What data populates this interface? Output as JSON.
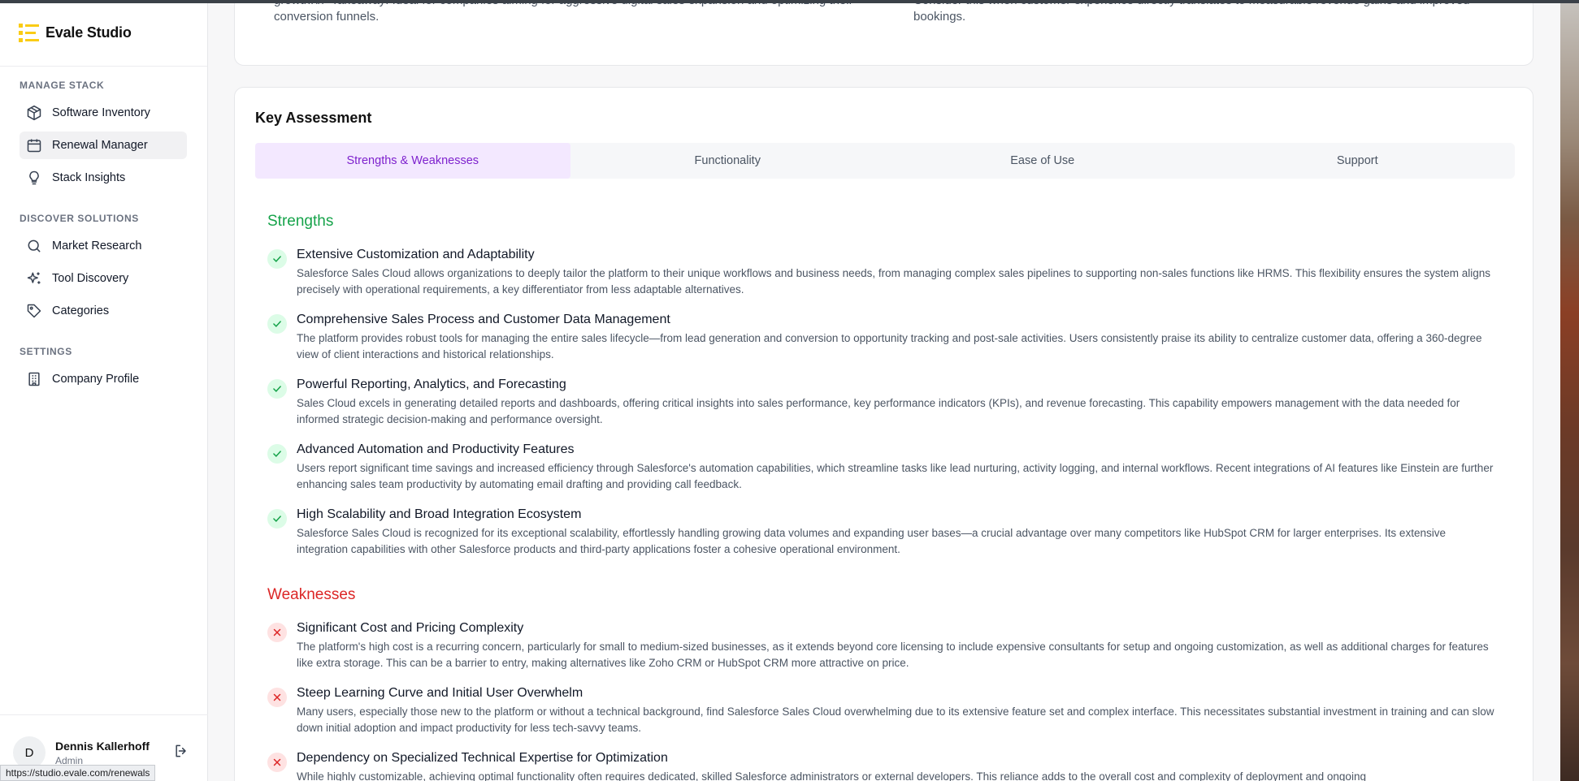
{
  "brand": {
    "name": "Evale Studio"
  },
  "sidebar": {
    "sections": [
      {
        "label": "MANAGE STACK",
        "items": [
          {
            "label": "Software Inventory",
            "icon": "box-icon"
          },
          {
            "label": "Renewal Manager",
            "icon": "calendar-icon",
            "active": true
          },
          {
            "label": "Stack Insights",
            "icon": "lightbulb-icon"
          }
        ]
      },
      {
        "label": "DISCOVER SOLUTIONS",
        "items": [
          {
            "label": "Market Research",
            "icon": "search-icon"
          },
          {
            "label": "Tool Discovery",
            "icon": "sparkles-icon"
          },
          {
            "label": "Categories",
            "icon": "tag-icon"
          }
        ]
      },
      {
        "label": "SETTINGS",
        "items": [
          {
            "label": "Company Profile",
            "icon": "building-icon"
          }
        ]
      }
    ]
  },
  "user": {
    "initial": "D",
    "name": "Dennis Kallerhoff",
    "role": "Admin"
  },
  "status_url": "https://studio.evale.com/renewals",
  "top_card": {
    "left_text": "growth.\\n- Takeaway: Ideal for companies aiming for aggressive digital sales expansion and optimizing their conversion funnels.",
    "right_text": "Consider this when customer experience directly translates to measurable revenue gains and improved bookings."
  },
  "assessment": {
    "title": "Key Assessment",
    "tabs": [
      "Strengths & Weaknesses",
      "Functionality",
      "Ease of Use",
      "Support"
    ],
    "active_tab": 0,
    "strengths_heading": "Strengths",
    "weaknesses_heading": "Weaknesses",
    "strengths": [
      {
        "title": "Extensive Customization and Adaptability",
        "desc": "Salesforce Sales Cloud allows organizations to deeply tailor the platform to their unique workflows and business needs, from managing complex sales pipelines to supporting non-sales functions like HRMS. This flexibility ensures the system aligns precisely with operational requirements, a key differentiator from less adaptable alternatives."
      },
      {
        "title": "Comprehensive Sales Process and Customer Data Management",
        "desc": "The platform provides robust tools for managing the entire sales lifecycle—from lead generation and conversion to opportunity tracking and post-sale activities. Users consistently praise its ability to centralize customer data, offering a 360-degree view of client interactions and historical relationships."
      },
      {
        "title": "Powerful Reporting, Analytics, and Forecasting",
        "desc": "Sales Cloud excels in generating detailed reports and dashboards, offering critical insights into sales performance, key performance indicators (KPIs), and revenue forecasting. This capability empowers management with the data needed for informed strategic decision-making and performance oversight."
      },
      {
        "title": "Advanced Automation and Productivity Features",
        "desc": "Users report significant time savings and increased efficiency through Salesforce's automation capabilities, which streamline tasks like lead nurturing, activity logging, and internal workflows. Recent integrations of AI features like Einstein are further enhancing sales team productivity by automating email drafting and providing call feedback."
      },
      {
        "title": "High Scalability and Broad Integration Ecosystem",
        "desc": "Salesforce Sales Cloud is recognized for its exceptional scalability, effortlessly handling growing data volumes and expanding user bases—a crucial advantage over many competitors like HubSpot CRM for larger enterprises. Its extensive integration capabilities with other Salesforce products and third-party applications foster a cohesive operational environment."
      }
    ],
    "weaknesses": [
      {
        "title": "Significant Cost and Pricing Complexity",
        "desc": "The platform's high cost is a recurring concern, particularly for small to medium-sized businesses, as it extends beyond core licensing to include expensive consultants for setup and ongoing customization, as well as additional charges for features like extra storage. This can be a barrier to entry, making alternatives like Zoho CRM or HubSpot CRM more attractive on price."
      },
      {
        "title": "Steep Learning Curve and Initial User Overwhelm",
        "desc": "Many users, especially those new to the platform or without a technical background, find Salesforce Sales Cloud overwhelming due to its extensive feature set and complex interface. This necessitates substantial investment in training and can slow down initial adoption and impact productivity for less tech-savvy teams."
      },
      {
        "title": "Dependency on Specialized Technical Expertise for Optimization",
        "desc": "While highly customizable, achieving optimal functionality often requires dedicated, skilled Salesforce administrators or external developers. This reliance adds to the overall cost and complexity of deployment and ongoing"
      }
    ]
  },
  "colors": {
    "accent": "#7e22ce",
    "success": "#16a34a",
    "danger": "#dc2626",
    "brand_yellow": "#facc15"
  }
}
